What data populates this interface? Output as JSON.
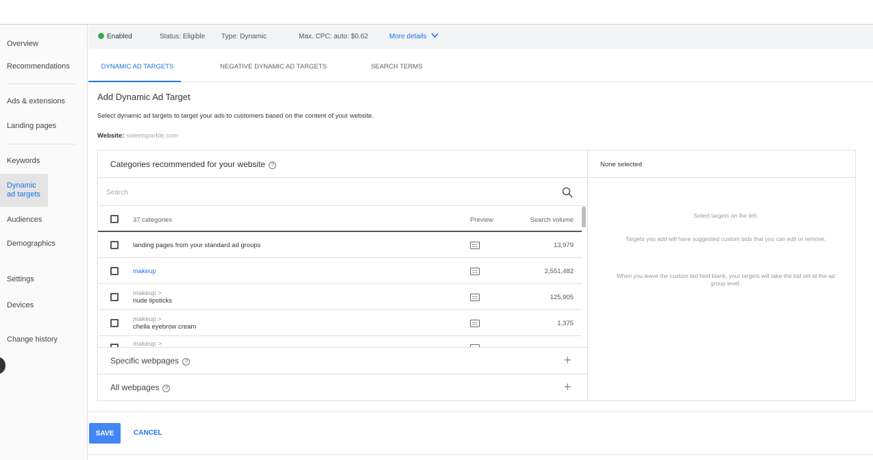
{
  "sidebar": {
    "items": [
      {
        "label": "Overview"
      },
      {
        "label": "Recommendations"
      },
      {
        "label": "Ads & extensions"
      },
      {
        "label": "Landing pages"
      },
      {
        "label": "Keywords"
      },
      {
        "label": "Dynamic ad targets"
      },
      {
        "label": "Audiences"
      },
      {
        "label": "Demographics"
      },
      {
        "label": "Settings"
      },
      {
        "label": "Devices"
      },
      {
        "label": "Change history"
      }
    ]
  },
  "status_bar": {
    "enabled": "Enabled",
    "status": "Status: Eligible",
    "type": "Type: Dynamic",
    "max_cpc": "Max. CPC: auto: $0.62",
    "more_details": "More details"
  },
  "tabs": [
    {
      "label": "DYNAMIC AD TARGETS"
    },
    {
      "label": "NEGATIVE DYNAMIC AD TARGETS"
    },
    {
      "label": "SEARCH TERMS"
    }
  ],
  "main": {
    "title": "Add Dynamic Ad Target",
    "description": "Select dynamic ad targets to target your ads to customers based on the content of your website.",
    "website_label": "Website:",
    "website_value": "sweetsparkle.com"
  },
  "categories": {
    "heading": "Categories recommended for your website",
    "search_placeholder": "Search",
    "header": {
      "count_label": "37 categories",
      "preview": "Preview",
      "search_volume": "Search volume"
    },
    "rows": [
      {
        "parent": "",
        "label": "landing pages from your standard ad groups",
        "volume": "13,979",
        "link": false
      },
      {
        "parent": "",
        "label": "makeup",
        "volume": "2,551,482",
        "link": true
      },
      {
        "parent": "makeup >",
        "label": "nude lipsticks",
        "volume": "125,905",
        "link": false
      },
      {
        "parent": "makeup >",
        "label": "chella eyebrow cream",
        "volume": "1,375",
        "link": false
      },
      {
        "parent": "makeup >",
        "label": "",
        "volume": "",
        "link": false
      }
    ]
  },
  "specific_webpages": "Specific webpages",
  "all_webpages": "All webpages",
  "selection": {
    "title": "None selected",
    "hint1": "Select targets on the left.",
    "hint2": "Targets you add will have suggested custom bids that you can edit or remove.",
    "hint3": "When you leave the custom bid field blank, your targets will take the bid set at the ad group level."
  },
  "footer": {
    "save": "SAVE",
    "cancel": "CANCEL"
  },
  "colors": {
    "accent": "#1a73e8",
    "save_button": "#4285f4",
    "enabled_dot": "#34a853"
  }
}
